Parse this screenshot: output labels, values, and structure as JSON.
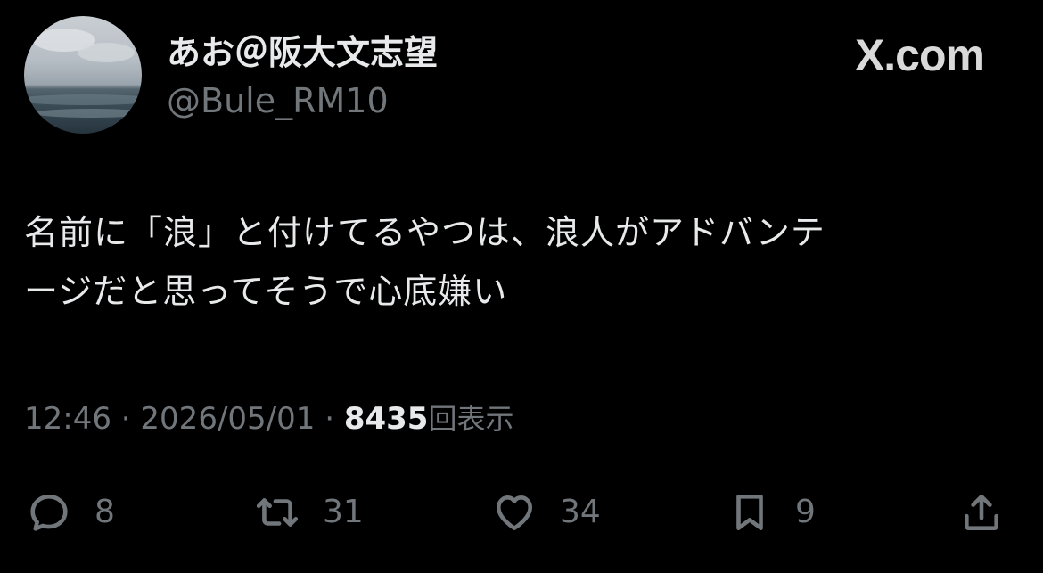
{
  "author": {
    "display_name": "あお＠阪大文志望",
    "handle": "@Bule_RM10",
    "avatar": "avatar-sea-photo"
  },
  "brand": {
    "logo_text": "X.com"
  },
  "tweet": {
    "lines": [
      "名前に「浪」と付けてるやつは、浪人がアドバンテ",
      "ージだと思ってそうで心底嫌い"
    ]
  },
  "meta": {
    "time": "12:46",
    "separator": " · ",
    "date": "2026/05/01",
    "views_count": "8435",
    "views_label": "回表示"
  },
  "actions": {
    "reply": {
      "icon": "reply-icon",
      "count": "8"
    },
    "retweet": {
      "icon": "retweet-icon",
      "count": "31"
    },
    "like": {
      "icon": "heart-icon",
      "count": "34"
    },
    "bookmark": {
      "icon": "bookmark-icon",
      "count": "9"
    },
    "share": {
      "icon": "share-icon"
    }
  },
  "colors": {
    "background": "#000000",
    "primary_text": "#e7e9ea",
    "secondary_text": "#71767b"
  }
}
